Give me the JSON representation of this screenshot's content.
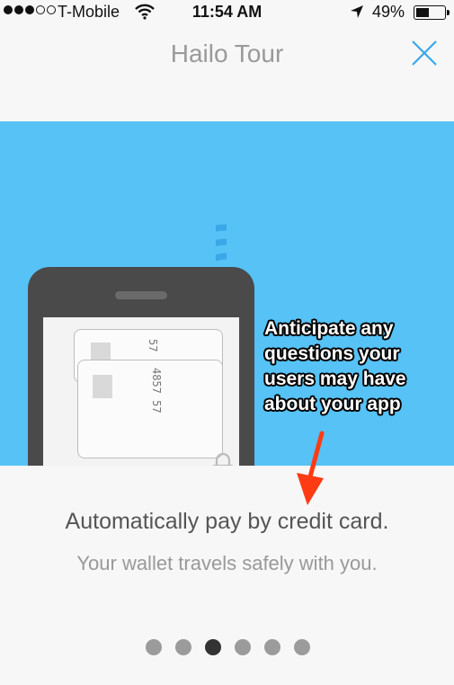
{
  "status_bar": {
    "carrier": "T-Mobile",
    "time": "11:54 AM",
    "battery": "49%",
    "battery_level": 0.49,
    "signal_bars": 3,
    "signal_total": 5
  },
  "nav": {
    "title": "Hailo Tour",
    "close_icon": "close-icon"
  },
  "hero": {
    "background_color": "#56c2f6",
    "card_number_front": "4857 57",
    "card_number_back": "57"
  },
  "annotation": {
    "text": "Anticipate any questions your users may have about your app",
    "arrow_color": "#ff3b14"
  },
  "content": {
    "headline": "Automatically pay by credit card.",
    "subline": "Your wallet travels safely with you."
  },
  "pager": {
    "total": 6,
    "active_index": 2
  }
}
